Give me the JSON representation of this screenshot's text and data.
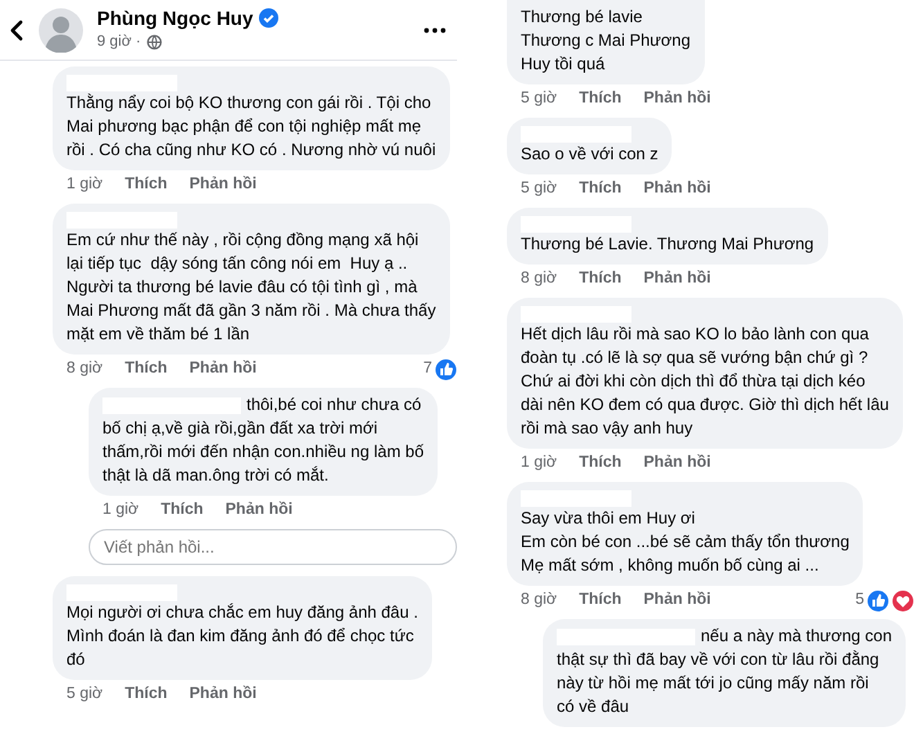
{
  "left_panel": {
    "post_header": {
      "author": "Phùng Ngọc Huy",
      "time": "9 giờ ·"
    },
    "comments": [
      {
        "kind": "comment",
        "text": "Thằng nẩy coi bộ KO thương con gái rồi . Tội cho\nMai phương bạc phận để con tội nghiệp mất mẹ\nrồi . Có cha cũng như KO có . Nương nhờ vú nuôi",
        "time": "1 giờ",
        "like_label": "Thích",
        "reply_label": "Phản hồi"
      },
      {
        "kind": "comment",
        "text": "Em cứ như thế này , rồi cộng đồng mạng xã hội\nlại tiếp tục  dậy sóng tấn công nói em  Huy ạ ..\nNgười ta thương bé lavie đâu có tội tình gì , mà\nMai Phương mất đã gần 3 năm rồi . Mà chưa thấy\nmặt em về thăm bé 1 lần",
        "time": "8 giờ",
        "like_label": "Thích",
        "reply_label": "Phản hồi",
        "reaction_count": "7",
        "reactions": [
          {
            "kind": "like"
          }
        ]
      },
      {
        "kind": "reply",
        "text": "thôi,bé coi như chưa có\nbố chị ạ,về già rồi,gần đất xa trời mới\nthấm,rồi mới đến nhận con.nhiều ng làm bố\nthật là dã man.ông trời có mắt.",
        "time": "1 giờ",
        "like_label": "Thích",
        "reply_label": "Phản hồi"
      },
      {
        "kind": "reply_field",
        "placeholder": "Viết phản hồi..."
      },
      {
        "kind": "comment",
        "text": "Mọi người ơi chưa chắc em huy đăng ảnh đâu .\nMình đoán là đan kim đăng ảnh đó để chọc tức\nđó",
        "time": "5 giờ",
        "like_label": "Thích",
        "reply_label": "Phản hồi"
      }
    ]
  },
  "right_panel": {
    "comments": [
      {
        "kind": "cut_comment",
        "text": "Thương bé lavie\nThương c Mai Phương\nHuy tồi quá",
        "time": "5 giờ",
        "like_label": "Thích",
        "reply_label": "Phản hồi"
      },
      {
        "kind": "comment",
        "text": "Sao o về với con z",
        "time": "5 giờ",
        "like_label": "Thích",
        "reply_label": "Phản hồi"
      },
      {
        "kind": "comment",
        "text": "Thương bé Lavie. Thương Mai Phương",
        "time": "8 giờ",
        "like_label": "Thích",
        "reply_label": "Phản hồi"
      },
      {
        "kind": "comment",
        "text": "Hết dịch lâu rồi mà sao KO lo bảo lành con qua\nđoàn tụ .có lẽ là sợ qua sẽ vướng bận chứ gì ?\nChứ ai đời khi còn dịch thì đổ thừa tại dịch kéo\ndài nên KO đem có qua được. Giờ thì dịch hết lâu\nrồi mà sao vậy anh huy",
        "time": "1 giờ",
        "like_label": "Thích",
        "reply_label": "Phản hồi"
      },
      {
        "kind": "comment",
        "text": "Say vừa thôi em Huy ơi\nEm còn bé con ...bé sẽ cảm thấy tổn thương\nMẹ mất sớm , không muốn bố cùng ai ...",
        "time": "8 giờ",
        "like_label": "Thích",
        "reply_label": "Phản hồi",
        "reaction_count": "5",
        "reactions": [
          {
            "kind": "like"
          },
          {
            "kind": "love"
          }
        ]
      },
      {
        "kind": "reply",
        "text": "nếu a này mà thương con\nthật sự thì đã bay về với con từ lâu rồi đằng\nnày từ hồi mẹ mất tới jo cũng mấy năm rồi\ncó về đâu"
      }
    ]
  }
}
